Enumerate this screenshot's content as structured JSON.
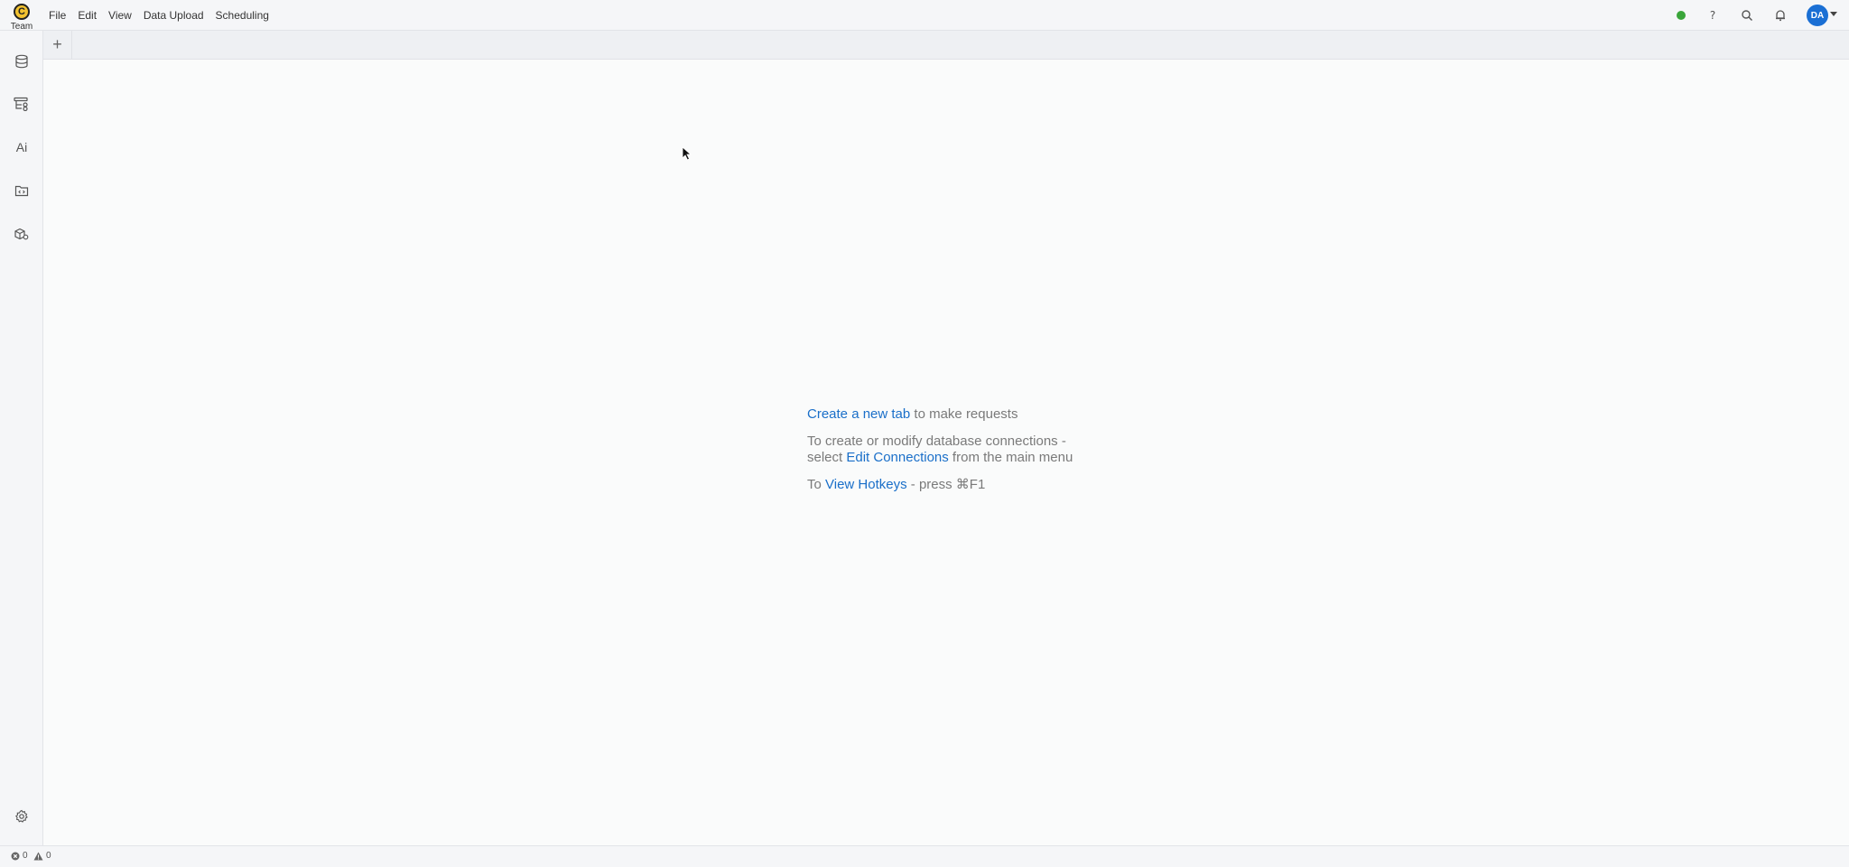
{
  "app": {
    "logo_letter": "C",
    "logo_label": "Team"
  },
  "menu": {
    "items": [
      {
        "label": "File"
      },
      {
        "label": "Edit"
      },
      {
        "label": "View"
      },
      {
        "label": "Data Upload"
      },
      {
        "label": "Scheduling"
      }
    ]
  },
  "header": {
    "status_color": "#3aa53a",
    "help_icon": "help-icon",
    "search_icon": "search-icon",
    "bell_icon": "bell-icon",
    "avatar_initials": "DA",
    "avatar_color": "#1a6fd4"
  },
  "sidebar": {
    "items": [
      {
        "icon": "database-icon"
      },
      {
        "icon": "schema-icon"
      },
      {
        "icon": "ai-icon",
        "label": "Ai"
      },
      {
        "icon": "code-folder-icon"
      },
      {
        "icon": "packages-icon"
      }
    ],
    "settings_icon": "gear-icon"
  },
  "tabs": {
    "add_label": "+"
  },
  "welcome": {
    "line1_link": "Create a new tab",
    "line1_rest": " to make requests",
    "line2_prefix": "To create or modify database connections -",
    "line2b_prefix": "select ",
    "line2_link": "Edit Connections",
    "line2_suffix": " from the main menu",
    "line3_prefix": "To ",
    "line3_link": "View Hotkeys",
    "line3_suffix": " - press ⌘F1"
  },
  "statusbar": {
    "errors": "0",
    "warnings": "0"
  }
}
